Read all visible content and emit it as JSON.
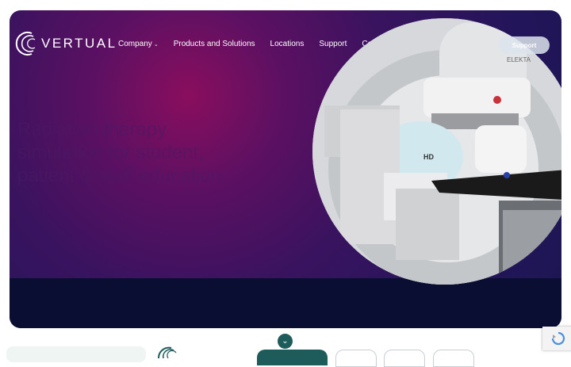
{
  "brand": {
    "name": "VERTUAL"
  },
  "nav": {
    "items": [
      {
        "label": "Company",
        "has_dropdown": true
      },
      {
        "label": "Products and Solutions"
      },
      {
        "label": "Locations"
      },
      {
        "label": "Support"
      },
      {
        "label": "Contact"
      }
    ],
    "support_button": "Support"
  },
  "hero": {
    "headline": "Radiation therapy simulation for student, patient & staff education"
  },
  "icons": {
    "logo": "vertual-swoosh-logo",
    "scroll": "chevron-down-icon",
    "recaptcha": "recaptcha-icon"
  },
  "colors": {
    "accent": "#1e5c5b",
    "hero_purple": "#5c1062",
    "hero_navy": "#0a0e33"
  }
}
